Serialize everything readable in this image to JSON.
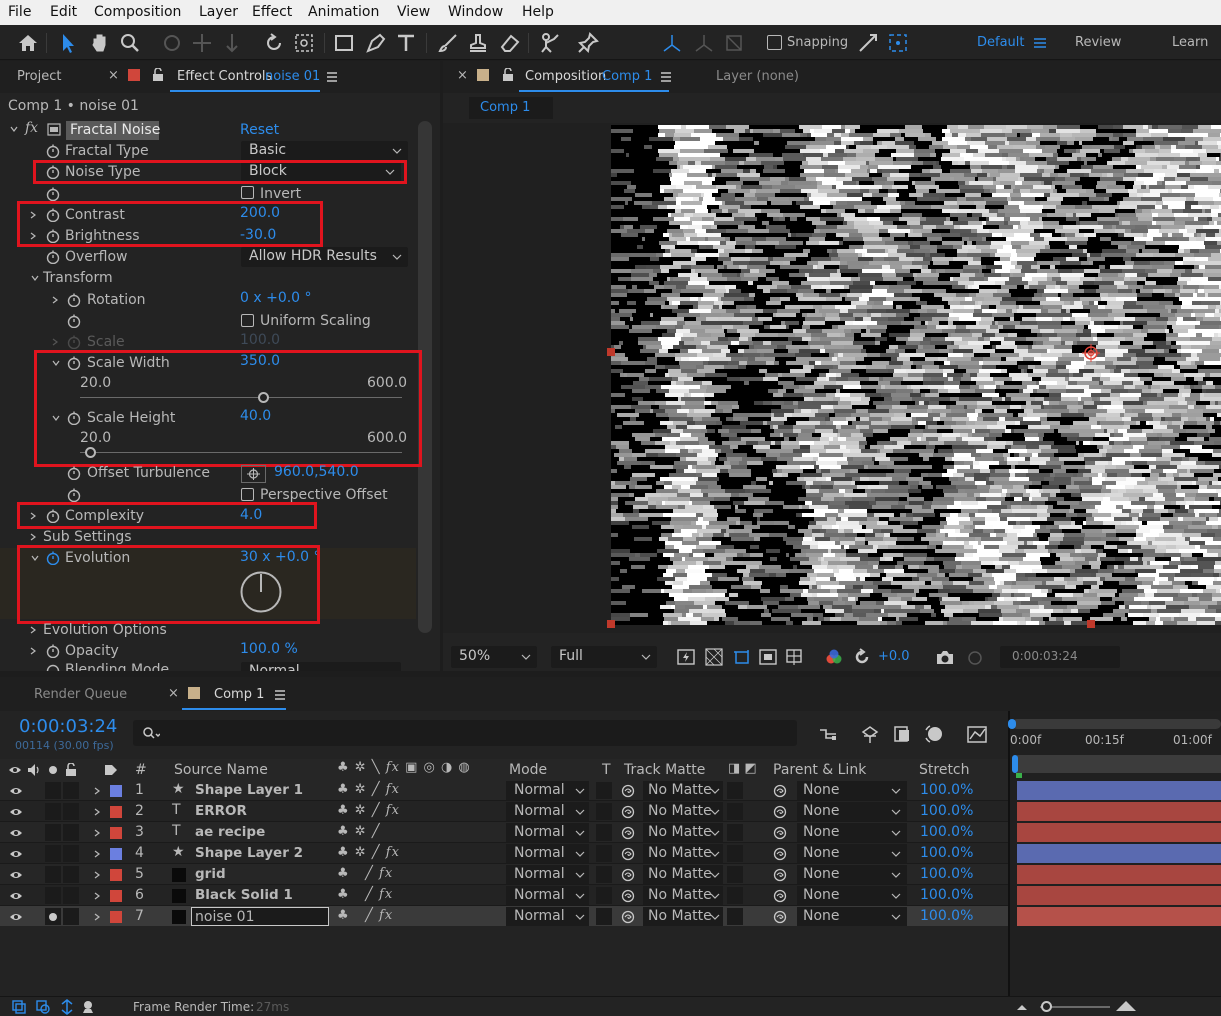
{
  "menu": [
    "File",
    "Edit",
    "Composition",
    "Layer",
    "Effect",
    "Animation",
    "View",
    "Window",
    "Help"
  ],
  "toolbar": {
    "snapping_label": "Snapping",
    "workspaces": [
      "Default",
      "Review",
      "Learn"
    ]
  },
  "left_panel": {
    "tab_project": "Project",
    "tab_effect_controls": "Effect Controls",
    "tab_effect_controls_layer": "noise 01",
    "breadcrumb": "Comp 1 • noise 01",
    "effect_name": "Fractal Noise",
    "reset_label": "Reset",
    "properties": {
      "fractal_type_label": "Fractal Type",
      "fractal_type_value": "Basic",
      "noise_type_label": "Noise Type",
      "noise_type_value": "Block",
      "invert_label": "Invert",
      "contrast_label": "Contrast",
      "contrast_value": "200.0",
      "brightness_label": "Brightness",
      "brightness_value": "-30.0",
      "overflow_label": "Overflow",
      "overflow_value": "Allow HDR Results",
      "transform_label": "Transform",
      "rotation_label": "Rotation",
      "rotation_value": "0 x +0.0 °",
      "uniform_scaling_label": "Uniform Scaling",
      "scale_label": "Scale",
      "scale_value": "100.0",
      "scale_width_label": "Scale Width",
      "scale_width_value": "350.0",
      "scale_width_min": "20.0",
      "scale_width_max": "600.0",
      "scale_width_fraction": 0.57,
      "scale_height_label": "Scale Height",
      "scale_height_value": "40.0",
      "scale_height_min": "20.0",
      "scale_height_max": "600.0",
      "scale_height_fraction": 0.035,
      "offset_turbulence_label": "Offset Turbulence",
      "offset_turbulence_value": "960.0,540.0",
      "perspective_offset_label": "Perspective Offset",
      "complexity_label": "Complexity",
      "complexity_value": "4.0",
      "sub_settings_label": "Sub Settings",
      "evolution_label": "Evolution",
      "evolution_value": "30 x +0.0 °",
      "evolution_options_label": "Evolution Options",
      "opacity_label": "Opacity",
      "opacity_value": "100.0 %",
      "blending_mode_label": "Blending Mode",
      "blending_mode_value": "Normal"
    }
  },
  "comp_panel": {
    "tab_label": "Composition",
    "tab_comp_name": "Comp 1",
    "layer_tab": "Layer (none)",
    "sub_tab": "Comp 1",
    "zoom": "50%",
    "resolution": "Full",
    "exposure": "+0.0",
    "timecode": "0:00:03:24"
  },
  "timeline": {
    "tab_render_queue": "Render Queue",
    "tab_comp": "Comp 1",
    "current_time": "0:00:03:24",
    "frame_info": "00114 (30.00 fps)",
    "columns": {
      "hash": "#",
      "source_name": "Source Name",
      "mode": "Mode",
      "t": "T",
      "track_matte": "Track Matte",
      "parent_link": "Parent & Link",
      "stretch": "Stretch"
    },
    "ruler": [
      "0:00f",
      "00:15f",
      "01:00f"
    ],
    "layers": [
      {
        "num": "1",
        "type": "★",
        "name": "Shape Layer 1",
        "mode": "Normal",
        "matte": "No Matte",
        "parent": "None",
        "stretch": "100.0%",
        "label_color": "#6b7fe0",
        "bar_color": "#5a6ab0"
      },
      {
        "num": "2",
        "type": "T",
        "name": "ERROR",
        "mode": "Normal",
        "matte": "No Matte",
        "parent": "None",
        "stretch": "100.0%",
        "label_color": "#d0463b",
        "bar_color": "#a84640"
      },
      {
        "num": "3",
        "type": "T",
        "name": "ae recipe",
        "mode": "Normal",
        "matte": "No Matte",
        "parent": "None",
        "stretch": "100.0%",
        "label_color": "#d0463b",
        "bar_color": "#a84640"
      },
      {
        "num": "4",
        "type": "★",
        "name": "Shape Layer 2",
        "mode": "Normal",
        "matte": "No Matte",
        "parent": "None",
        "stretch": "100.0%",
        "label_color": "#6b7fe0",
        "bar_color": "#5a6ab0"
      },
      {
        "num": "5",
        "type": "■",
        "name": "grid",
        "mode": "Normal",
        "matte": "No Matte",
        "parent": "None",
        "stretch": "100.0%",
        "label_color": "#d0463b",
        "bar_color": "#a84640"
      },
      {
        "num": "6",
        "type": "■",
        "name": "Black Solid 1",
        "mode": "Normal",
        "matte": "No Matte",
        "parent": "None",
        "stretch": "100.0%",
        "label_color": "#d0463b",
        "bar_color": "#a84640"
      },
      {
        "num": "7",
        "type": "■",
        "name": "noise 01",
        "mode": "Normal",
        "matte": "No Matte",
        "parent": "None",
        "stretch": "100.0%",
        "label_color": "#d0463b",
        "bar_color": "#b5514a"
      }
    ],
    "frame_render_label": "Frame Render Time:",
    "frame_render_value": "27ms"
  },
  "colors": {
    "accent_blue": "#2d8ceb",
    "highlight_red": "#e0141e",
    "panel_bg": "#232323"
  }
}
